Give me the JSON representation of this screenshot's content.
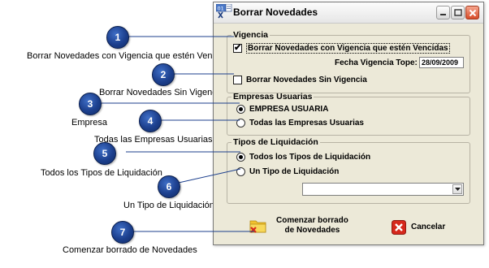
{
  "window": {
    "title": "Borrar Novedades",
    "icon_badge": "01",
    "controls": [
      "minimize-icon",
      "maximize-icon",
      "close-icon"
    ]
  },
  "vigencia": {
    "legend": "Vigencia",
    "borrar_con_vigencia_label": "Borrar Novedades con Vigencia que estén Vencidas",
    "borrar_con_vigencia_checked": true,
    "fecha_label": "Fecha Vigencia Tope:",
    "fecha_value": "28/09/2009",
    "borrar_sin_vigencia_label": "Borrar Novedades Sin Vigencia",
    "borrar_sin_vigencia_checked": false
  },
  "empresas": {
    "legend": "Empresas Usuarias",
    "empresa_label": "EMPRESA USUARIA",
    "todas_label": "Todas las Empresas Usuarias",
    "selected": "empresa"
  },
  "liquidacion": {
    "legend": "Tipos de Liquidación",
    "todos_label": "Todos los Tipos de Liquidación",
    "uno_label": "Un Tipo de Liquidación",
    "selected": "todos",
    "combo_value": ""
  },
  "buttons": {
    "comenzar_line1": "Comenzar borrado",
    "comenzar_line2": "de Novedades",
    "cancelar": "Cancelar"
  },
  "annotations": [
    {
      "number": "1",
      "text": "Borrar Novedades con Vigencia que estén Vencidas"
    },
    {
      "number": "2",
      "text": "Borrar Novedades Sin Vigencia"
    },
    {
      "number": "3",
      "text": "Empresa"
    },
    {
      "number": "4",
      "text": "Todas las Empresas Usuarias"
    },
    {
      "number": "5",
      "text": "Todos los Tipos de Liquidación"
    },
    {
      "number": "6",
      "text": "Un Tipo de Liquidación"
    },
    {
      "number": "7",
      "text": "Comenzar borrado de Novedades"
    }
  ],
  "colors": {
    "marker_blue": "#1c3f8d",
    "window_face": "#ece9d8",
    "close_red": "#d74b28",
    "folder_yellow": "#f2c230"
  }
}
